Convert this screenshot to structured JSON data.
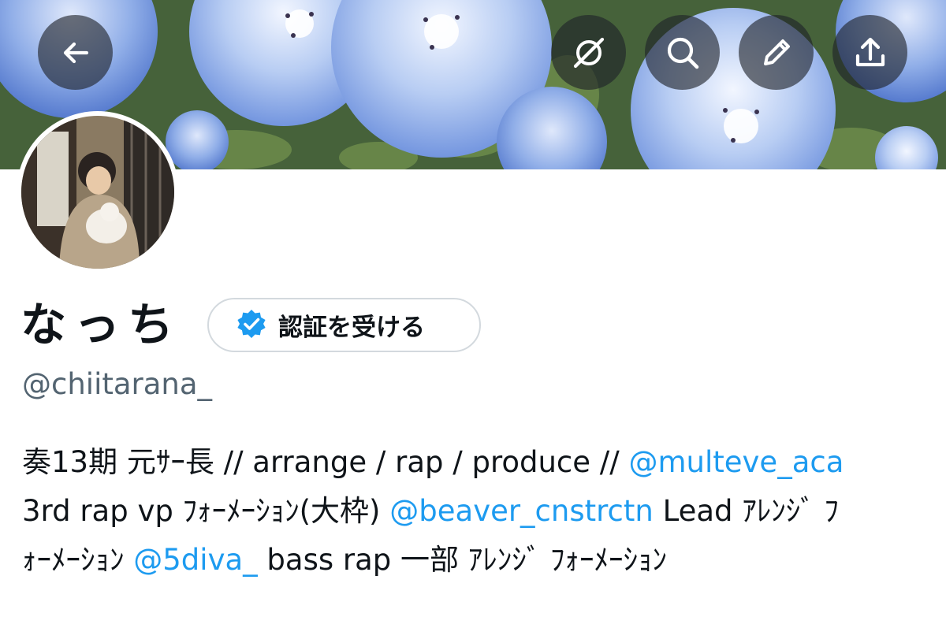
{
  "header": {
    "back_icon": "back-arrow-icon",
    "actions": [
      "spaces-icon",
      "search-icon",
      "edit-pencil-icon",
      "share-upload-icon"
    ]
  },
  "profile": {
    "display_name": "なっち",
    "verify_button_label": "認証を受ける",
    "verify_icon": "verified-badge-icon",
    "handle": "@chiitarana_"
  },
  "bio": {
    "line1": {
      "text1": "奏13期 元ｻｰ長 // arrange / rap / produce // ",
      "mention1": "@multeve_aca"
    },
    "line2": {
      "text1": "3rd rap vp ﾌｫｰﾒｰｼｮﾝ(大枠) ",
      "mention1": "@beaver_cnstrctn",
      "text2": " Lead ｱﾚﾝｼﾞ ﾌ"
    },
    "line3": {
      "text1": "ｫｰﾒｰｼｮﾝ ",
      "mention1": "@5diva_",
      "text2": " bass rap 一部 ｱﾚﾝｼﾞ  ﾌｫｰﾒｰｼｮﾝ"
    }
  },
  "colors": {
    "accent": "#1d9bf0",
    "text": "#0f1419",
    "secondary_text": "#536471",
    "border": "#d3d9de"
  }
}
